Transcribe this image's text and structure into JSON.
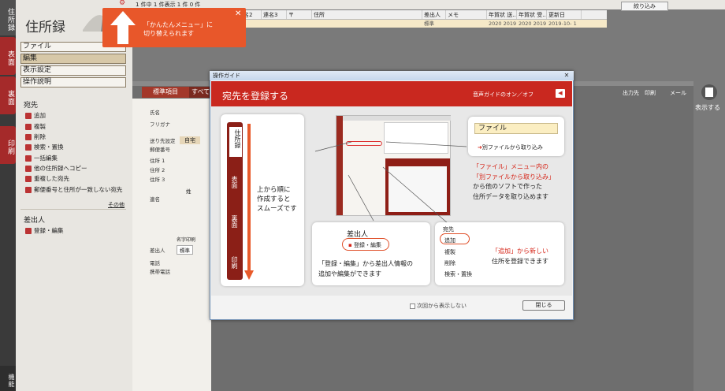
{
  "topbar": {
    "count_text": "1 件中 1 件表示 1 件 0 件",
    "filter_button": "絞り込み"
  },
  "grid": {
    "headers": [
      "連名2",
      "連名3",
      "〒",
      "住所",
      "差出人",
      "メモ",
      "年賀状 送...",
      "年賀状 受...",
      "更新日"
    ],
    "row": [
      "",
      "",
      "",
      "",
      "標準",
      "",
      "2020 2019 20...",
      "2020 2019 20...",
      "2019-10- 1"
    ]
  },
  "left_tabs": {
    "address_book": "住所録",
    "front": "表面",
    "back": "裏面",
    "print": "印刷",
    "functions": "機能"
  },
  "sidebar": {
    "logo": "住所録",
    "menus": [
      {
        "label": "ファイル",
        "selected": false
      },
      {
        "label": "編集",
        "selected": true
      },
      {
        "label": "表示設定",
        "selected": false
      },
      {
        "label": "操作説明",
        "selected": false
      }
    ],
    "recipient_title": "宛先",
    "recipient_items": [
      "追加",
      "複製",
      "削除",
      "検索・置換",
      "一括編集",
      "他の住所録へコピー",
      "重複した宛先",
      "郵便番号と住所が一致しない宛先"
    ],
    "other_link": "その他",
    "sender_title": "差出人",
    "sender_items": [
      "登録・編集"
    ]
  },
  "detail": {
    "std_tab": "標準項目",
    "all_tab": "すべて",
    "labels": [
      "氏名",
      "フリガナ",
      "送り先設定",
      "郵便番号",
      "住所 1",
      "住所 2",
      "住所 3",
      "連名",
      "差出人",
      "電話",
      "携帯電話"
    ],
    "home_value": "自宅",
    "sender_value": "標準",
    "surname_col": "姓",
    "suffix_check": "名字印刷",
    "right_labels": [
      "出力先",
      "印刷",
      "メール"
    ],
    "display_button": "表示する"
  },
  "tooltip": {
    "line1": "「かんたんメニュー」に",
    "line2": "切り替えられます",
    "close": "✕"
  },
  "dialog": {
    "title": "操作ガイド",
    "heading": "宛先を登録する",
    "voice": "音声ガイドのオン／オフ",
    "flow_tabs": [
      "住所録",
      "表面",
      "裏面",
      "印刷"
    ],
    "flow_text": [
      "上から順に",
      "作成すると",
      "スムーズです"
    ],
    "file_menu": "ファイル",
    "file_import": "別ファイルから取り込み",
    "file_desc": [
      "「ファイル」メニュー内の",
      "「別ファイルから取り込み」",
      "から他のソフトで作った",
      "住所データを取り込めます"
    ],
    "sender_card_title": "差出人",
    "sender_card_item": "登録・編集",
    "sender_desc": [
      "「登録・編集」から差出人情報の",
      "追加や編集ができます"
    ],
    "add_card_title": "宛先",
    "add_items": [
      "追加",
      "複製",
      "削除",
      "検索・置換"
    ],
    "add_desc": [
      "「追加」から新しい",
      "住所を登録できます"
    ],
    "checkbox_label": "次回から表示しない",
    "close_button": "閉じる"
  }
}
